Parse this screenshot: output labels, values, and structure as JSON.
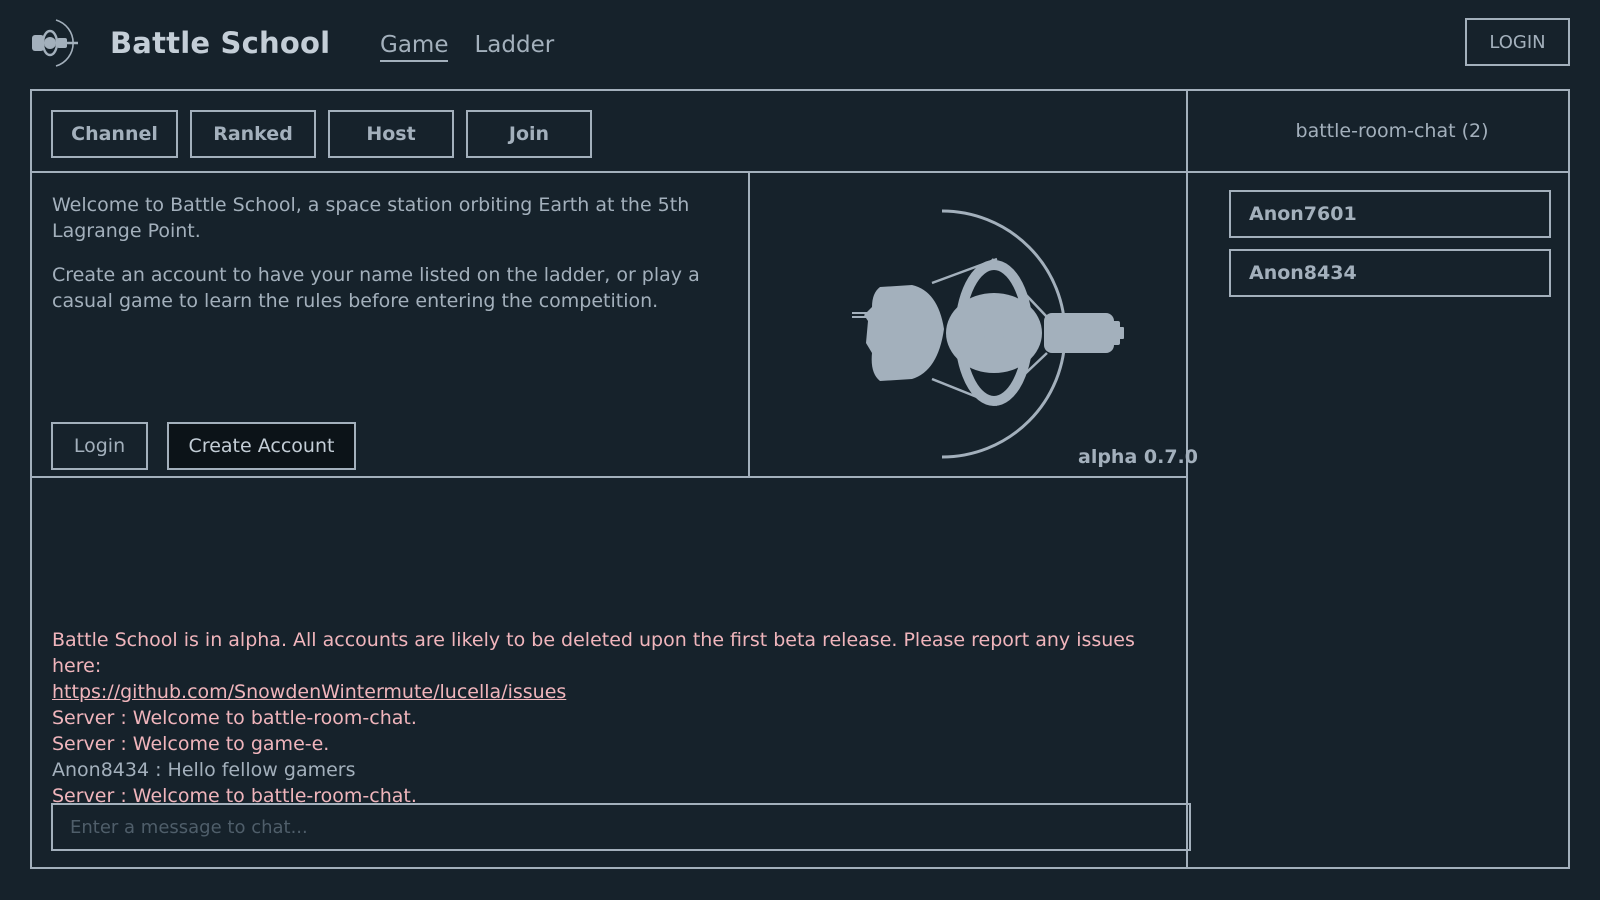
{
  "header": {
    "brand": "Battle School",
    "nav": [
      {
        "label": "Game",
        "active": true
      },
      {
        "label": "Ladder",
        "active": false
      }
    ],
    "login_label": "LOGIN"
  },
  "tabs": [
    {
      "label": "Channel"
    },
    {
      "label": "Ranked"
    },
    {
      "label": "Host"
    },
    {
      "label": "Join"
    }
  ],
  "welcome": {
    "para1": "Welcome to Battle School, a space station orbiting Earth at the 5th Lagrange Point.",
    "para2": "Create an account to have your name listed on the ladder, or play a casual game to learn the rules before entering the competition.",
    "login_button": "Login",
    "create_account_button": "Create Account"
  },
  "version": "alpha 0.7.0",
  "chat": {
    "title": "battle-room-chat (2)",
    "users": [
      "Anon7601",
      "Anon8434"
    ],
    "alpha_notice": "Battle School is in alpha. All accounts are likely to be deleted upon the first beta release. Please report any issues here:",
    "issues_link": "https://github.com/SnowdenWintermute/lucella/issues",
    "messages": [
      {
        "text": "Server : Welcome to battle-room-chat.",
        "kind": "server"
      },
      {
        "text": "Server : Welcome to game-e.",
        "kind": "server"
      },
      {
        "text": "Anon8434 : Hello fellow gamers",
        "kind": "user"
      },
      {
        "text": "Server : Welcome to battle-room-chat.",
        "kind": "server"
      }
    ],
    "input_placeholder": "Enter a message to chat..."
  },
  "colors": {
    "background": "#16222b",
    "foreground": "#a3b0bc",
    "server_message": "#f0b5bc",
    "dark_button": "#0c1318"
  },
  "icons": {
    "logo": "battle-school-station-icon",
    "hero": "space-station-illustration"
  }
}
